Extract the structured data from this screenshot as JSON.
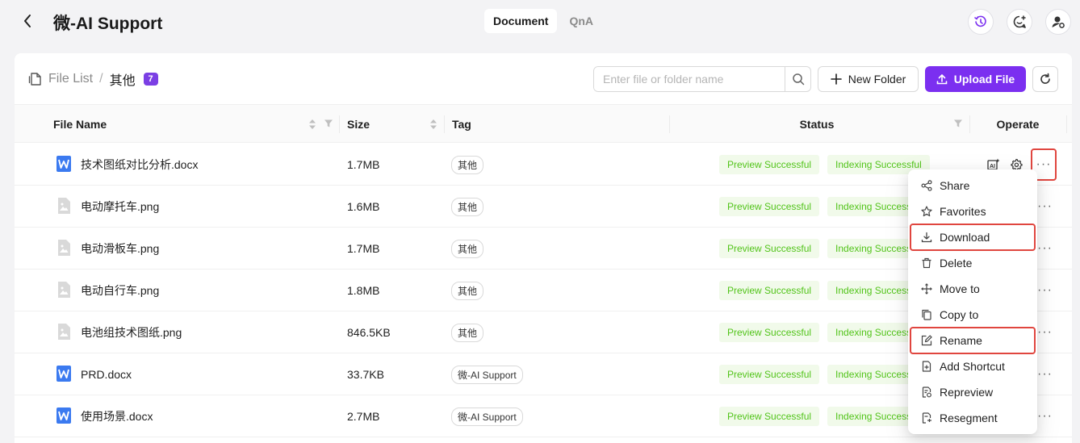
{
  "header": {
    "back_icon": "chevron-left-icon",
    "title": "微-AI Support",
    "tabs": [
      {
        "label": "Document",
        "active": true
      },
      {
        "label": "QnA",
        "active": false
      }
    ],
    "right_icons": [
      "history-icon",
      "chat-add-icon",
      "user-settings-icon"
    ],
    "accent_color": "#7b2ff0"
  },
  "toolbar": {
    "breadcrumb_icon": "files-icon",
    "breadcrumb_root": "File List",
    "breadcrumb_sep": "/",
    "breadcrumb_current": "其他",
    "count": "7",
    "search_placeholder": "Enter file or folder name",
    "new_folder_label": "New Folder",
    "upload_label": "Upload File"
  },
  "table": {
    "columns": [
      "File Name",
      "Size",
      "Tag",
      "Status",
      "Operate"
    ],
    "rows": [
      {
        "name": "技术图纸对比分析.docx",
        "icon": "word-doc-icon",
        "size": "1.7MB",
        "tag": "其他",
        "preview": "Preview Successful",
        "indexing": "Indexing Successful"
      },
      {
        "name": "电动摩托车.png",
        "icon": "image-icon",
        "size": "1.6MB",
        "tag": "其他",
        "preview": "Preview Successful",
        "indexing": "Indexing Successful"
      },
      {
        "name": "电动滑板车.png",
        "icon": "image-icon",
        "size": "1.7MB",
        "tag": "其他",
        "preview": "Preview Successful",
        "indexing": "Indexing Successful"
      },
      {
        "name": "电动自行车.png",
        "icon": "image-icon",
        "size": "1.8MB",
        "tag": "其他",
        "preview": "Preview Successful",
        "indexing": "Indexing Successful"
      },
      {
        "name": "电池组技术图纸.png",
        "icon": "image-icon",
        "size": "846.5KB",
        "tag": "其他",
        "preview": "Preview Successful",
        "indexing": "Indexing Successful"
      },
      {
        "name": "PRD.docx",
        "icon": "word-doc-icon",
        "size": "33.7KB",
        "tag": "微-AI Support",
        "preview": "Preview Successful",
        "indexing": "Indexing Successful"
      },
      {
        "name": "使用场景.docx",
        "icon": "word-doc-icon",
        "size": "2.7MB",
        "tag": "微-AI Support",
        "preview": "Preview Successful",
        "indexing": "Indexing Successful"
      }
    ]
  },
  "menu": {
    "items": [
      {
        "label": "Share",
        "icon": "share-icon"
      },
      {
        "label": "Favorites",
        "icon": "star-icon"
      },
      {
        "label": "Download",
        "icon": "download-icon"
      },
      {
        "label": "Delete",
        "icon": "trash-icon"
      },
      {
        "label": "Move to",
        "icon": "move-icon"
      },
      {
        "label": "Copy to",
        "icon": "copy-icon"
      },
      {
        "label": "Rename",
        "icon": "edit-icon"
      },
      {
        "label": "Add Shortcut",
        "icon": "shortcut-icon"
      },
      {
        "label": "Repreview",
        "icon": "repreview-icon"
      },
      {
        "label": "Resegment",
        "icon": "resegment-icon"
      }
    ]
  },
  "colors": {
    "accent": "#7b2ff0",
    "success": "#52c41a",
    "highlight": "#e0463f"
  }
}
